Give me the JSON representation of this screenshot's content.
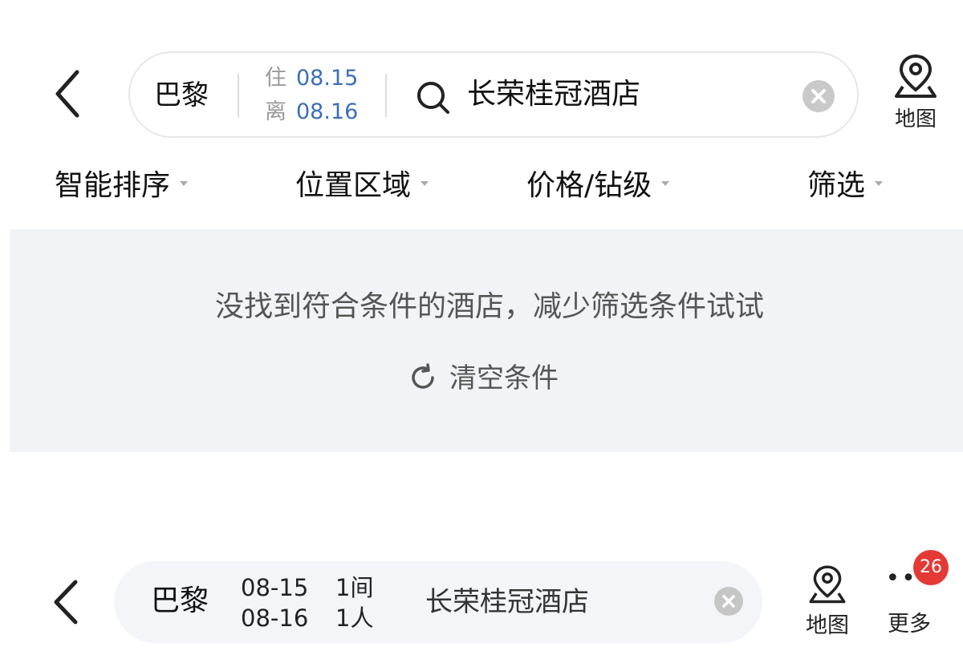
{
  "top_bar": {
    "city": "巴黎",
    "checkin_tag": "住",
    "checkin_date": "08.15",
    "checkout_tag": "离",
    "checkout_date": "08.16",
    "keyword": "长荣桂冠酒店",
    "map_label": "地图"
  },
  "filters": [
    {
      "label": "智能排序"
    },
    {
      "label": "位置区域"
    },
    {
      "label": "价格/钻级"
    },
    {
      "label": "筛选"
    }
  ],
  "empty_state": {
    "message": "没找到符合条件的酒店，减少筛选条件试试",
    "reset_label": "清空条件"
  },
  "bottom_bar": {
    "city": "巴黎",
    "checkin_date": "08-15",
    "checkout_date": "08-16",
    "rooms": "1间",
    "guests": "1人",
    "keyword": "长荣桂冠酒店",
    "map_label": "地图",
    "more_label": "更多",
    "badge_count": "26"
  },
  "colors": {
    "date_blue": "#3b6fb8",
    "badge_red": "#e53935",
    "panel_bg": "#f1f3f6"
  }
}
